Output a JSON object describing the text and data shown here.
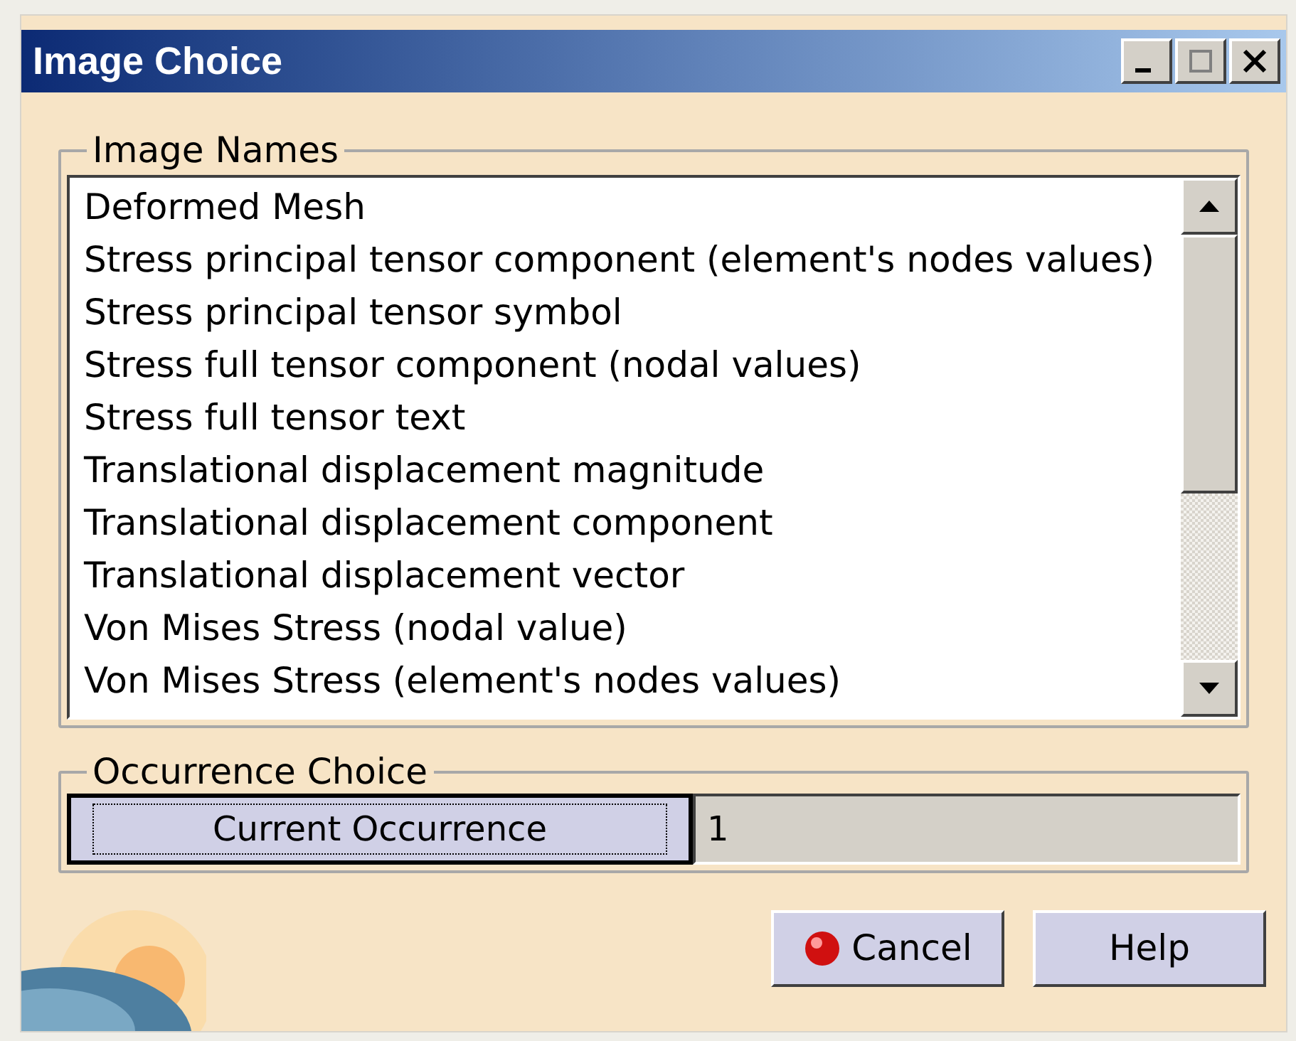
{
  "window": {
    "title": "Image Choice"
  },
  "image_names": {
    "legend": "Image Names",
    "items": [
      "Deformed Mesh",
      "Stress principal tensor component (element's nodes values)",
      "Stress principal tensor symbol",
      "Stress full tensor component (nodal values)",
      "Stress full tensor text",
      "Translational displacement magnitude",
      "Translational displacement component",
      "Translational displacement vector",
      "Von Mises Stress (nodal value)",
      "Von Mises Stress (element's nodes values)"
    ]
  },
  "occurrence": {
    "legend": "Occurrence Choice",
    "button": "Current Occurrence",
    "value": "1"
  },
  "buttons": [
    {
      "label": "Cancel",
      "kind": "cancel"
    },
    {
      "label": "Help",
      "kind": "plain"
    }
  ]
}
